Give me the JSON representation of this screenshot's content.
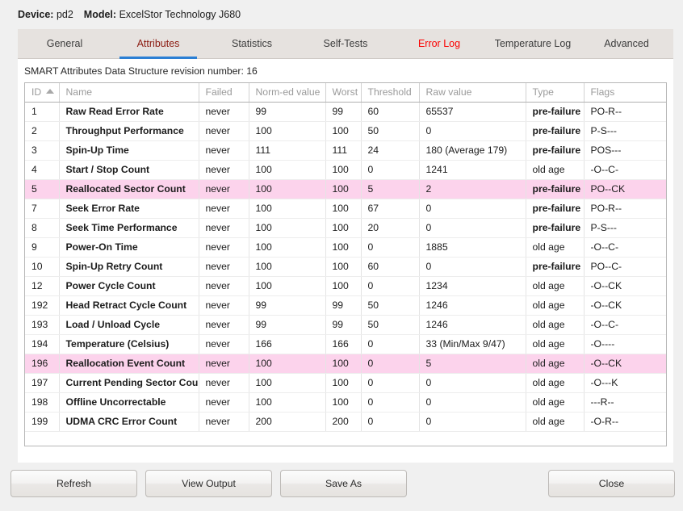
{
  "device": {
    "device_label": "Device:",
    "device_value": "pd2",
    "model_label": "Model:",
    "model_value": "ExcelStor Technology J680"
  },
  "tabs": [
    {
      "label": "General",
      "state": "normal"
    },
    {
      "label": "Attributes",
      "state": "active"
    },
    {
      "label": "Statistics",
      "state": "normal"
    },
    {
      "label": "Self-Tests",
      "state": "normal"
    },
    {
      "label": "Error Log",
      "state": "alert"
    },
    {
      "label": "Temperature Log",
      "state": "normal"
    },
    {
      "label": "Advanced",
      "state": "normal"
    }
  ],
  "panel": {
    "revision_text": "SMART Attributes Data Structure revision number: 16"
  },
  "table": {
    "sort_column": "ID",
    "sort_direction": "ascending",
    "columns": [
      "ID",
      "Name",
      "Failed",
      "Norm-ed value",
      "Worst",
      "Threshold",
      "Raw value",
      "Type",
      "Flags"
    ],
    "rows": [
      {
        "id": "1",
        "name": "Raw Read Error Rate",
        "failed": "never",
        "normed": "99",
        "worst": "99",
        "threshold": "60",
        "raw": "65537",
        "type": "pre-failure",
        "flags": "PO-R--",
        "highlight": false
      },
      {
        "id": "2",
        "name": "Throughput Performance",
        "failed": "never",
        "normed": "100",
        "worst": "100",
        "threshold": "50",
        "raw": "0",
        "type": "pre-failure",
        "flags": "P-S---",
        "highlight": false
      },
      {
        "id": "3",
        "name": "Spin-Up Time",
        "failed": "never",
        "normed": "111",
        "worst": "111",
        "threshold": "24",
        "raw": "180 (Average 179)",
        "type": "pre-failure",
        "flags": "POS---",
        "highlight": false
      },
      {
        "id": "4",
        "name": "Start / Stop Count",
        "failed": "never",
        "normed": "100",
        "worst": "100",
        "threshold": "0",
        "raw": "1241",
        "type": "old age",
        "flags": "-O--C-",
        "highlight": false
      },
      {
        "id": "5",
        "name": "Reallocated Sector Count",
        "failed": "never",
        "normed": "100",
        "worst": "100",
        "threshold": "5",
        "raw": "2",
        "type": "pre-failure",
        "flags": "PO--CK",
        "highlight": true
      },
      {
        "id": "7",
        "name": "Seek Error Rate",
        "failed": "never",
        "normed": "100",
        "worst": "100",
        "threshold": "67",
        "raw": "0",
        "type": "pre-failure",
        "flags": "PO-R--",
        "highlight": false
      },
      {
        "id": "8",
        "name": "Seek Time Performance",
        "failed": "never",
        "normed": "100",
        "worst": "100",
        "threshold": "20",
        "raw": "0",
        "type": "pre-failure",
        "flags": "P-S---",
        "highlight": false
      },
      {
        "id": "9",
        "name": "Power-On Time",
        "failed": "never",
        "normed": "100",
        "worst": "100",
        "threshold": "0",
        "raw": "1885",
        "type": "old age",
        "flags": "-O--C-",
        "highlight": false
      },
      {
        "id": "10",
        "name": "Spin-Up Retry Count",
        "failed": "never",
        "normed": "100",
        "worst": "100",
        "threshold": "60",
        "raw": "0",
        "type": "pre-failure",
        "flags": "PO--C-",
        "highlight": false
      },
      {
        "id": "12",
        "name": "Power Cycle Count",
        "failed": "never",
        "normed": "100",
        "worst": "100",
        "threshold": "0",
        "raw": "1234",
        "type": "old age",
        "flags": "-O--CK",
        "highlight": false
      },
      {
        "id": "192",
        "name": "Head Retract Cycle Count",
        "failed": "never",
        "normed": "99",
        "worst": "99",
        "threshold": "50",
        "raw": "1246",
        "type": "old age",
        "flags": "-O--CK",
        "highlight": false
      },
      {
        "id": "193",
        "name": "Load / Unload Cycle",
        "failed": "never",
        "normed": "99",
        "worst": "99",
        "threshold": "50",
        "raw": "1246",
        "type": "old age",
        "flags": "-O--C-",
        "highlight": false
      },
      {
        "id": "194",
        "name": "Temperature (Celsius)",
        "failed": "never",
        "normed": "166",
        "worst": "166",
        "threshold": "0",
        "raw": "33 (Min/Max 9/47)",
        "type": "old age",
        "flags": "-O----",
        "highlight": false
      },
      {
        "id": "196",
        "name": "Reallocation Event Count",
        "failed": "never",
        "normed": "100",
        "worst": "100",
        "threshold": "0",
        "raw": "5",
        "type": "old age",
        "flags": "-O--CK",
        "highlight": true
      },
      {
        "id": "197",
        "name": "Current Pending Sector Count",
        "failed": "never",
        "normed": "100",
        "worst": "100",
        "threshold": "0",
        "raw": "0",
        "type": "old age",
        "flags": "-O---K",
        "highlight": false
      },
      {
        "id": "198",
        "name": "Offline Uncorrectable",
        "failed": "never",
        "normed": "100",
        "worst": "100",
        "threshold": "0",
        "raw": "0",
        "type": "old age",
        "flags": "---R--",
        "highlight": false
      },
      {
        "id": "199",
        "name": "UDMA CRC Error Count",
        "failed": "never",
        "normed": "200",
        "worst": "200",
        "threshold": "0",
        "raw": "0",
        "type": "old age",
        "flags": "-O-R--",
        "highlight": false
      }
    ]
  },
  "buttons": {
    "refresh": "Refresh",
    "view_output": "View Output",
    "save_as": "Save As",
    "close": "Close"
  },
  "colors": {
    "accent_tab_underline": "#2b7fd4",
    "active_tab_text": "#8b1a10",
    "alert_tab_text": "#fb0000",
    "row_highlight": "#fcd3ec",
    "panel_background": "#ffffff",
    "window_background": "#f0f0f0"
  }
}
